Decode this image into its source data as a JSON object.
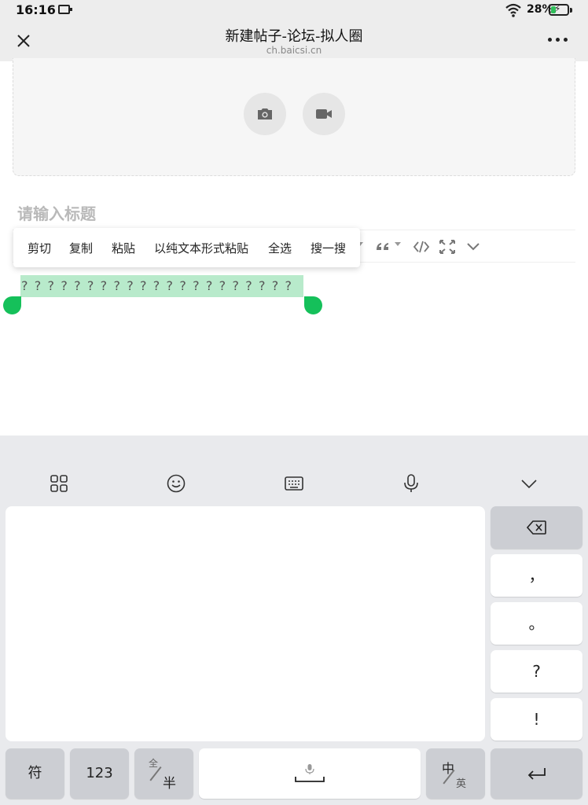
{
  "status_bar": {
    "time": "16:16",
    "battery_percent": "28%",
    "battery_level": 0.28,
    "battery_charging": true
  },
  "nav": {
    "title": "新建帖子-论坛-拟人圈",
    "url": "ch.baicsi.cn",
    "close_icon": "close-icon",
    "more_icon": "more-icon"
  },
  "upload": {
    "photo_icon": "camera-icon",
    "video_icon": "video-camera-icon"
  },
  "title_input": {
    "placeholder": "请输入标题"
  },
  "toolbar": {
    "quote_icon": "quote-icon",
    "code_icon": "code-icon",
    "fullscreen_icon": "fullscreen-icon",
    "expand_icon": "chevron-down-icon"
  },
  "context_menu": {
    "items": [
      "剪切",
      "复制",
      "粘贴",
      "以纯文本形式粘贴",
      "全选",
      "搜一搜"
    ]
  },
  "editor": {
    "selected_text": "? ? ? ? ? ? ? ? ? ? ? ? ? ? ? ? ? ? ? ? ?"
  },
  "keyboard": {
    "toolbar_icons": [
      "grid-icon",
      "emoji-icon",
      "keyboard-icon",
      "microphone-icon",
      "chevron-down-icon"
    ],
    "right_column": {
      "backspace_icon": "backspace-icon",
      "punct": [
        "，",
        "。",
        "?",
        "!"
      ]
    },
    "bottom_row": {
      "symbol": "符",
      "numbers": "123",
      "full_half_top": "全",
      "full_half_bottom": "半",
      "space_icon": "space-mic-icon",
      "lang_top": "中",
      "lang_bottom": "英",
      "enter_icon": "enter-icon"
    },
    "colors": {
      "background": "#e9eaed",
      "key": "#ffffff",
      "dark_key": "#ccced3"
    }
  },
  "colors": {
    "selection": "#b8eacb",
    "handle": "#15c05a"
  }
}
